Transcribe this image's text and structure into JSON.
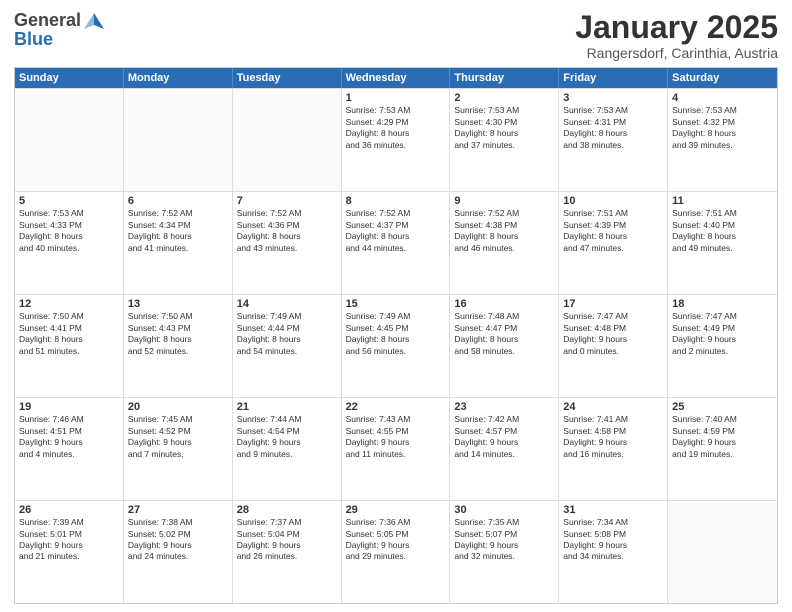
{
  "header": {
    "logo_general": "General",
    "logo_blue": "Blue",
    "month": "January 2025",
    "location": "Rangersdorf, Carinthia, Austria"
  },
  "days_of_week": [
    "Sunday",
    "Monday",
    "Tuesday",
    "Wednesday",
    "Thursday",
    "Friday",
    "Saturday"
  ],
  "weeks": [
    [
      {
        "day": "",
        "info": ""
      },
      {
        "day": "",
        "info": ""
      },
      {
        "day": "",
        "info": ""
      },
      {
        "day": "1",
        "info": "Sunrise: 7:53 AM\nSunset: 4:29 PM\nDaylight: 8 hours\nand 36 minutes."
      },
      {
        "day": "2",
        "info": "Sunrise: 7:53 AM\nSunset: 4:30 PM\nDaylight: 8 hours\nand 37 minutes."
      },
      {
        "day": "3",
        "info": "Sunrise: 7:53 AM\nSunset: 4:31 PM\nDaylight: 8 hours\nand 38 minutes."
      },
      {
        "day": "4",
        "info": "Sunrise: 7:53 AM\nSunset: 4:32 PM\nDaylight: 8 hours\nand 39 minutes."
      }
    ],
    [
      {
        "day": "5",
        "info": "Sunrise: 7:53 AM\nSunset: 4:33 PM\nDaylight: 8 hours\nand 40 minutes."
      },
      {
        "day": "6",
        "info": "Sunrise: 7:52 AM\nSunset: 4:34 PM\nDaylight: 8 hours\nand 41 minutes."
      },
      {
        "day": "7",
        "info": "Sunrise: 7:52 AM\nSunset: 4:36 PM\nDaylight: 8 hours\nand 43 minutes."
      },
      {
        "day": "8",
        "info": "Sunrise: 7:52 AM\nSunset: 4:37 PM\nDaylight: 8 hours\nand 44 minutes."
      },
      {
        "day": "9",
        "info": "Sunrise: 7:52 AM\nSunset: 4:38 PM\nDaylight: 8 hours\nand 46 minutes."
      },
      {
        "day": "10",
        "info": "Sunrise: 7:51 AM\nSunset: 4:39 PM\nDaylight: 8 hours\nand 47 minutes."
      },
      {
        "day": "11",
        "info": "Sunrise: 7:51 AM\nSunset: 4:40 PM\nDaylight: 8 hours\nand 49 minutes."
      }
    ],
    [
      {
        "day": "12",
        "info": "Sunrise: 7:50 AM\nSunset: 4:41 PM\nDaylight: 8 hours\nand 51 minutes."
      },
      {
        "day": "13",
        "info": "Sunrise: 7:50 AM\nSunset: 4:43 PM\nDaylight: 8 hours\nand 52 minutes."
      },
      {
        "day": "14",
        "info": "Sunrise: 7:49 AM\nSunset: 4:44 PM\nDaylight: 8 hours\nand 54 minutes."
      },
      {
        "day": "15",
        "info": "Sunrise: 7:49 AM\nSunset: 4:45 PM\nDaylight: 8 hours\nand 56 minutes."
      },
      {
        "day": "16",
        "info": "Sunrise: 7:48 AM\nSunset: 4:47 PM\nDaylight: 8 hours\nand 58 minutes."
      },
      {
        "day": "17",
        "info": "Sunrise: 7:47 AM\nSunset: 4:48 PM\nDaylight: 9 hours\nand 0 minutes."
      },
      {
        "day": "18",
        "info": "Sunrise: 7:47 AM\nSunset: 4:49 PM\nDaylight: 9 hours\nand 2 minutes."
      }
    ],
    [
      {
        "day": "19",
        "info": "Sunrise: 7:46 AM\nSunset: 4:51 PM\nDaylight: 9 hours\nand 4 minutes."
      },
      {
        "day": "20",
        "info": "Sunrise: 7:45 AM\nSunset: 4:52 PM\nDaylight: 9 hours\nand 7 minutes."
      },
      {
        "day": "21",
        "info": "Sunrise: 7:44 AM\nSunset: 4:54 PM\nDaylight: 9 hours\nand 9 minutes."
      },
      {
        "day": "22",
        "info": "Sunrise: 7:43 AM\nSunset: 4:55 PM\nDaylight: 9 hours\nand 11 minutes."
      },
      {
        "day": "23",
        "info": "Sunrise: 7:42 AM\nSunset: 4:57 PM\nDaylight: 9 hours\nand 14 minutes."
      },
      {
        "day": "24",
        "info": "Sunrise: 7:41 AM\nSunset: 4:58 PM\nDaylight: 9 hours\nand 16 minutes."
      },
      {
        "day": "25",
        "info": "Sunrise: 7:40 AM\nSunset: 4:59 PM\nDaylight: 9 hours\nand 19 minutes."
      }
    ],
    [
      {
        "day": "26",
        "info": "Sunrise: 7:39 AM\nSunset: 5:01 PM\nDaylight: 9 hours\nand 21 minutes."
      },
      {
        "day": "27",
        "info": "Sunrise: 7:38 AM\nSunset: 5:02 PM\nDaylight: 9 hours\nand 24 minutes."
      },
      {
        "day": "28",
        "info": "Sunrise: 7:37 AM\nSunset: 5:04 PM\nDaylight: 9 hours\nand 26 minutes."
      },
      {
        "day": "29",
        "info": "Sunrise: 7:36 AM\nSunset: 5:05 PM\nDaylight: 9 hours\nand 29 minutes."
      },
      {
        "day": "30",
        "info": "Sunrise: 7:35 AM\nSunset: 5:07 PM\nDaylight: 9 hours\nand 32 minutes."
      },
      {
        "day": "31",
        "info": "Sunrise: 7:34 AM\nSunset: 5:08 PM\nDaylight: 9 hours\nand 34 minutes."
      },
      {
        "day": "",
        "info": ""
      }
    ]
  ]
}
